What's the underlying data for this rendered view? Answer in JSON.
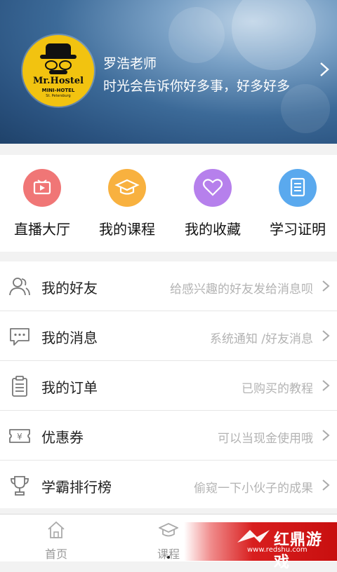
{
  "profile": {
    "name": "罗浩老师",
    "motto": "时光会告诉你好多事，好多好多",
    "avatar_brand": "Mr.Hostel",
    "avatar_sub": "MINI-HOTEL",
    "avatar_sub2": "St. Petersburg"
  },
  "quick_menu": [
    {
      "label": "直播大厅",
      "icon": "tv-icon",
      "color": "#f07676"
    },
    {
      "label": "我的课程",
      "icon": "graduation-cap-icon",
      "color": "#f8b13f"
    },
    {
      "label": "我的收藏",
      "icon": "heart-icon",
      "color": "#b680ec"
    },
    {
      "label": "学习证明",
      "icon": "document-icon",
      "color": "#5aa9ee"
    }
  ],
  "list": [
    {
      "label": "我的好友",
      "hint": "给感兴趣的好友发给消息呗",
      "icon": "friends-icon"
    },
    {
      "label": "我的消息",
      "hint": "系统通知 /好友消息",
      "icon": "message-icon"
    },
    {
      "label": "我的订单",
      "hint": "已购买的教程",
      "icon": "clipboard-icon"
    },
    {
      "label": "优惠券",
      "hint": "可以当现金使用哦",
      "icon": "coupon-icon"
    },
    {
      "label": "学霸排行榜",
      "hint": "偷窥一下小伙子的成果",
      "icon": "trophy-icon"
    }
  ],
  "nav": [
    {
      "label": "首页",
      "icon": "home-icon"
    },
    {
      "label": "课程",
      "icon": "course-icon"
    },
    {
      "label": "",
      "icon": "profile-icon"
    }
  ],
  "watermark": {
    "text": "红鼎游戏",
    "url": "www.redshu.com"
  },
  "colors": {
    "accent_red": "#d81e1e",
    "hint_gray": "#b3b3b3"
  }
}
